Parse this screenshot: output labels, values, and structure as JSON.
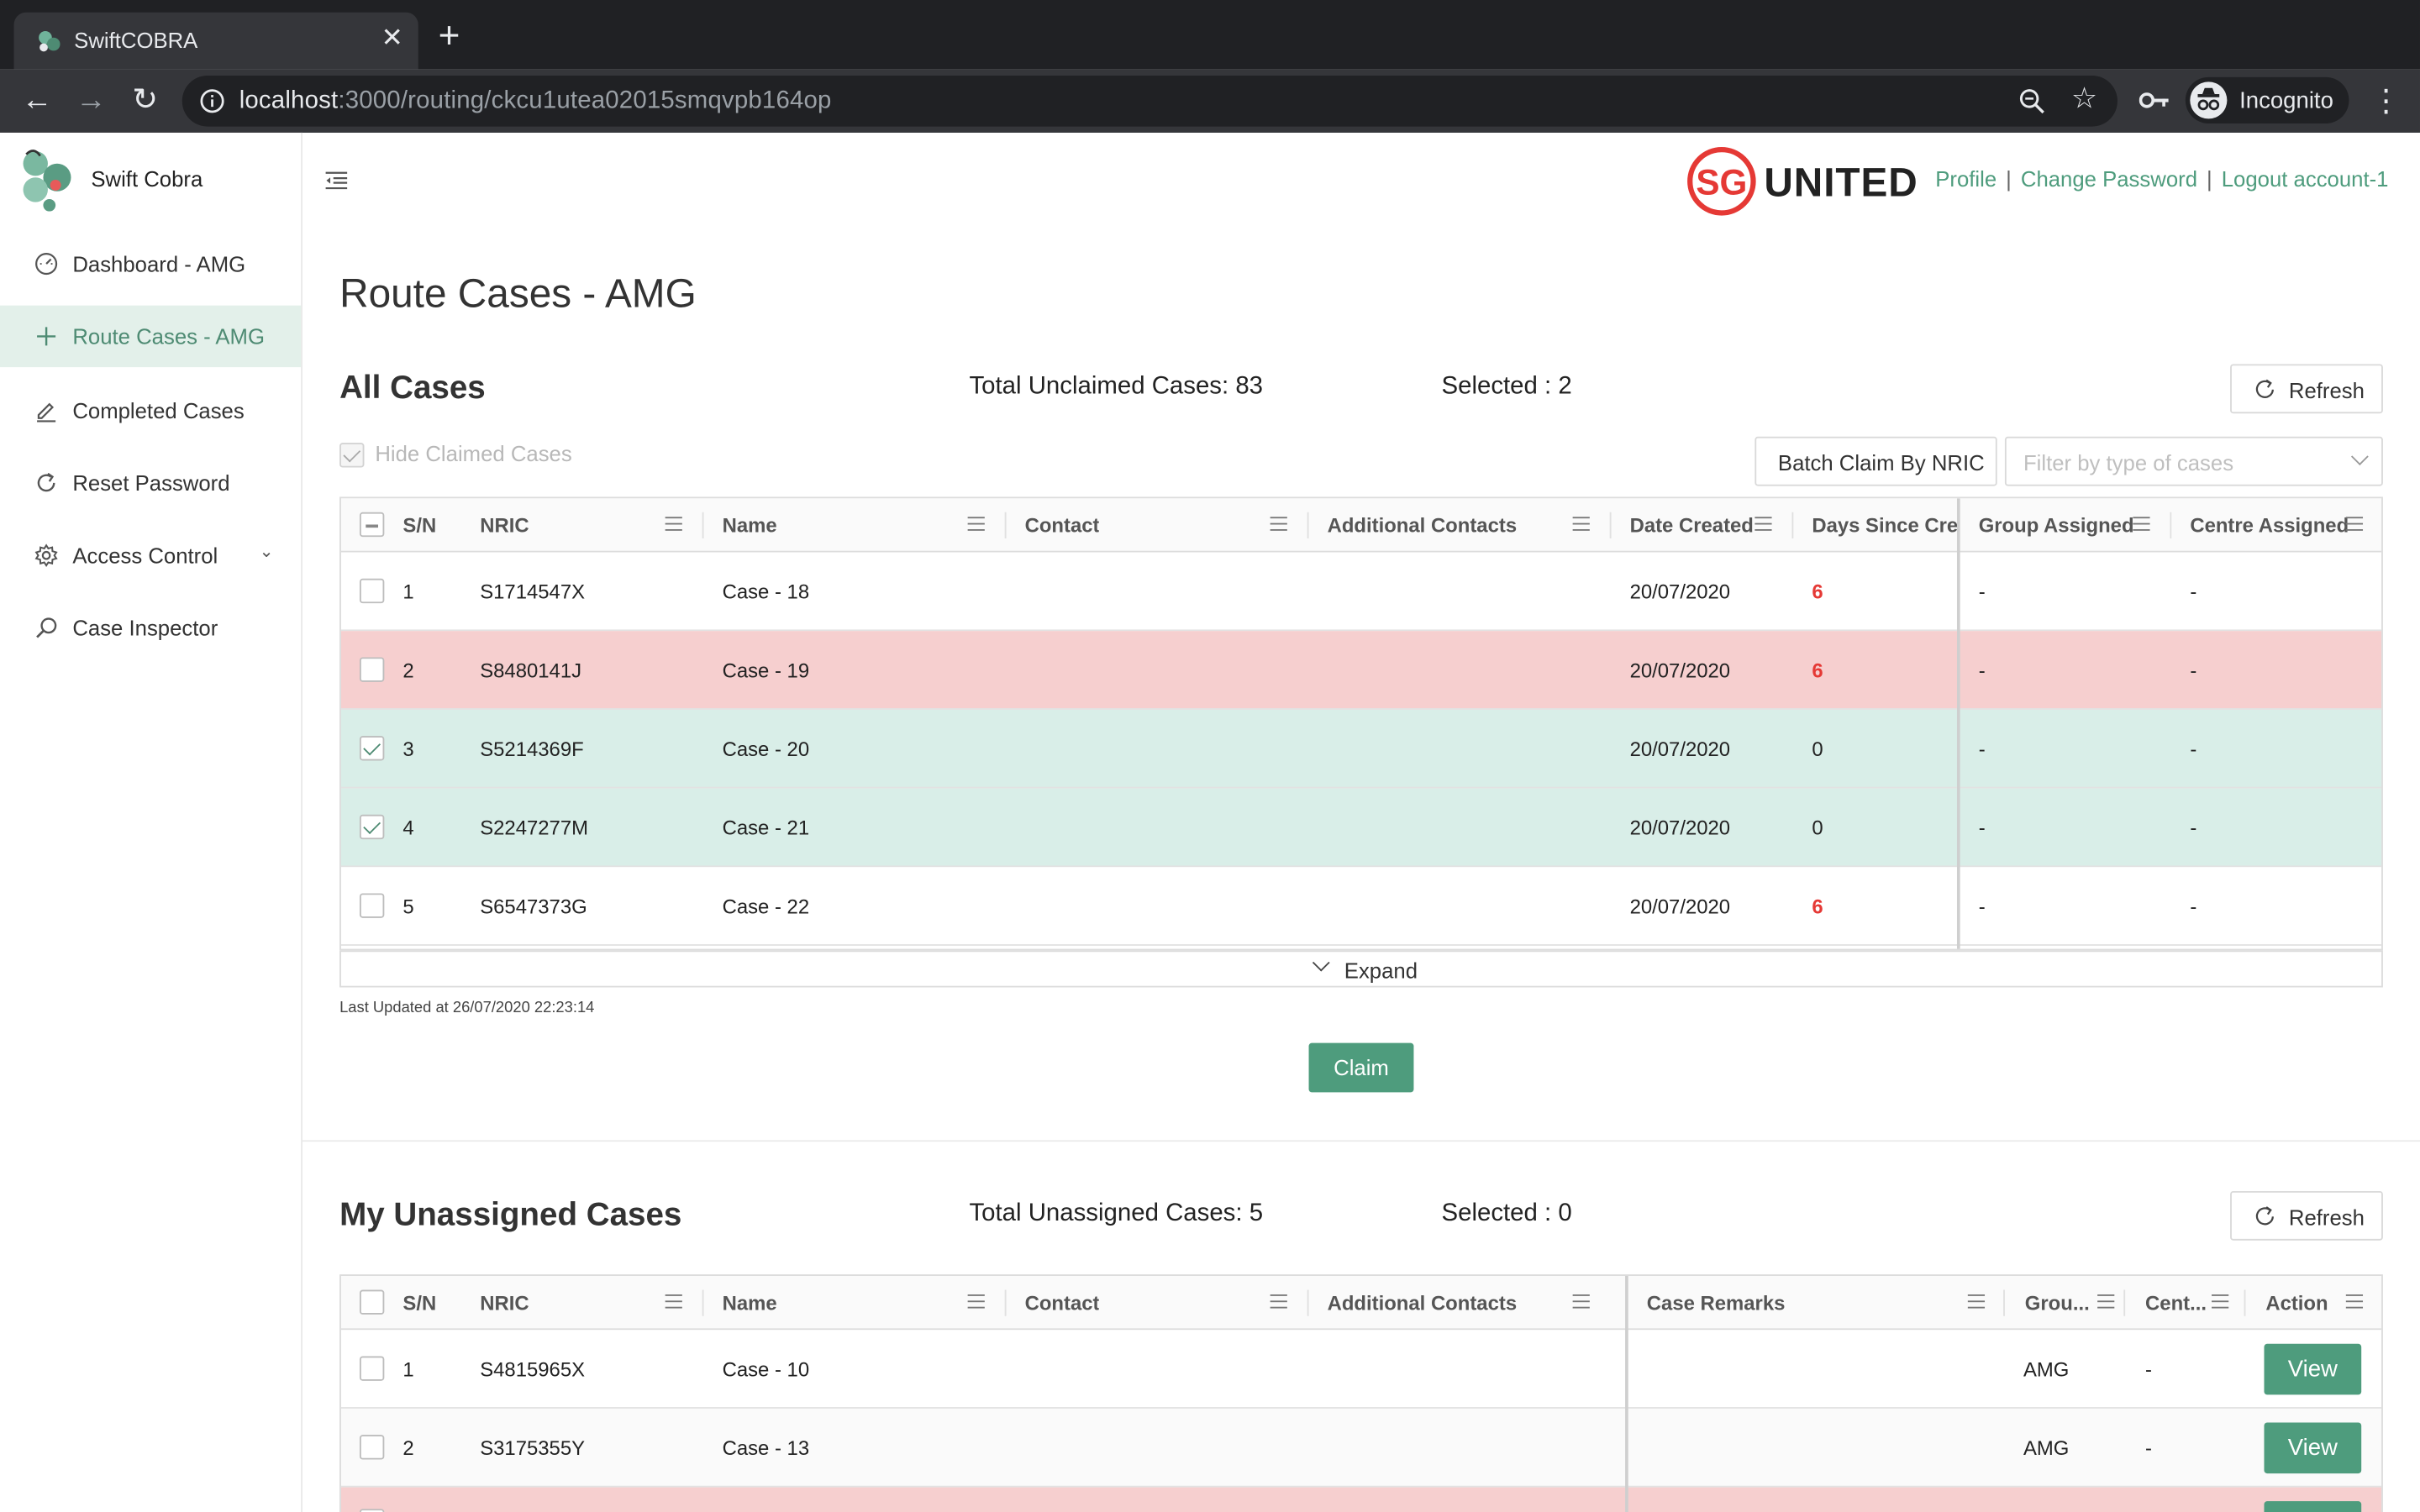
{
  "browser": {
    "tab_title": "SwiftCOBRA",
    "url_host": "localhost",
    "url_rest": ":3000/routing/ckcu1utea02015smqvpb164op",
    "profile_label": "Incognito"
  },
  "sidebar": {
    "brand": "Swift Cobra",
    "items": [
      {
        "label": "Dashboard - AMG",
        "icon": "dashboard-icon"
      },
      {
        "label": "Route Cases - AMG",
        "icon": "plus-icon"
      },
      {
        "label": "Completed Cases",
        "icon": "edit-icon"
      },
      {
        "label": "Reset Password",
        "icon": "reload-icon"
      },
      {
        "label": "Access Control",
        "icon": "gear-icon"
      },
      {
        "label": "Case Inspector",
        "icon": "search-icon"
      }
    ]
  },
  "header": {
    "logo_sg": "SG",
    "logo_united": "UNITED",
    "links": [
      "Profile",
      "Change Password",
      "Logout account-1"
    ]
  },
  "page_title": "Route Cases - AMG",
  "all_cases": {
    "title": "All Cases",
    "total": "Total Unclaimed Cases: 83",
    "selected": "Selected : 2",
    "refresh_label": "Refresh",
    "hide_claimed_label": "Hide Claimed Cases",
    "batch_claim_label": "Batch Claim By NRIC",
    "filter_placeholder": "Filter by type of cases",
    "columns": [
      "S/N",
      "NRIC",
      "Name",
      "Contact",
      "Additional Contacts",
      "Date Created",
      "Days Since Crea",
      "Group Assigned",
      "Centre Assigned"
    ],
    "rows": [
      {
        "sn": "1",
        "nric": "S1714547X",
        "name": "Case - 18",
        "contact": "",
        "additional": "",
        "date": "20/07/2020",
        "days": "6",
        "group": "-",
        "centre": "-",
        "checked": false
      },
      {
        "sn": "2",
        "nric": "S8480141J",
        "name": "Case - 19",
        "contact": "",
        "additional": "",
        "date": "20/07/2020",
        "days": "6",
        "group": "-",
        "centre": "-",
        "checked": false
      },
      {
        "sn": "3",
        "nric": "S5214369F",
        "name": "Case - 20",
        "contact": "",
        "additional": "",
        "date": "20/07/2020",
        "days": "0",
        "group": "-",
        "centre": "-",
        "checked": true
      },
      {
        "sn": "4",
        "nric": "S2247277M",
        "name": "Case - 21",
        "contact": "",
        "additional": "",
        "date": "20/07/2020",
        "days": "0",
        "group": "-",
        "centre": "-",
        "checked": true
      },
      {
        "sn": "5",
        "nric": "S6547373G",
        "name": "Case - 22",
        "contact": "",
        "additional": "",
        "date": "20/07/2020",
        "days": "6",
        "group": "-",
        "centre": "-",
        "checked": false
      }
    ],
    "expand_label": "Expand",
    "last_updated": "Last Updated at 26/07/2020 22:23:14",
    "claim_label": "Claim"
  },
  "unassigned": {
    "title": "My Unassigned Cases",
    "total": "Total Unassigned Cases: 5",
    "selected": "Selected : 0",
    "refresh_label": "Refresh",
    "columns": [
      "S/N",
      "NRIC",
      "Name",
      "Contact",
      "Additional Contacts",
      "Case Remarks",
      "Grou...",
      "Cent...",
      "Action"
    ],
    "rows": [
      {
        "sn": "1",
        "nric": "S4815965X",
        "name": "Case - 10",
        "contact": "",
        "additional": "",
        "remarks": "",
        "group": "AMG",
        "centre": "-",
        "action": "View"
      },
      {
        "sn": "2",
        "nric": "S3175355Y",
        "name": "Case - 13",
        "contact": "",
        "additional": "",
        "remarks": "",
        "group": "AMG",
        "centre": "-",
        "action": "View"
      }
    ]
  },
  "colors": {
    "accent": "#4e9c7d",
    "row_danger": "#f6cfcf",
    "row_selected": "#d9eee8",
    "alert_text": "#e53935"
  }
}
